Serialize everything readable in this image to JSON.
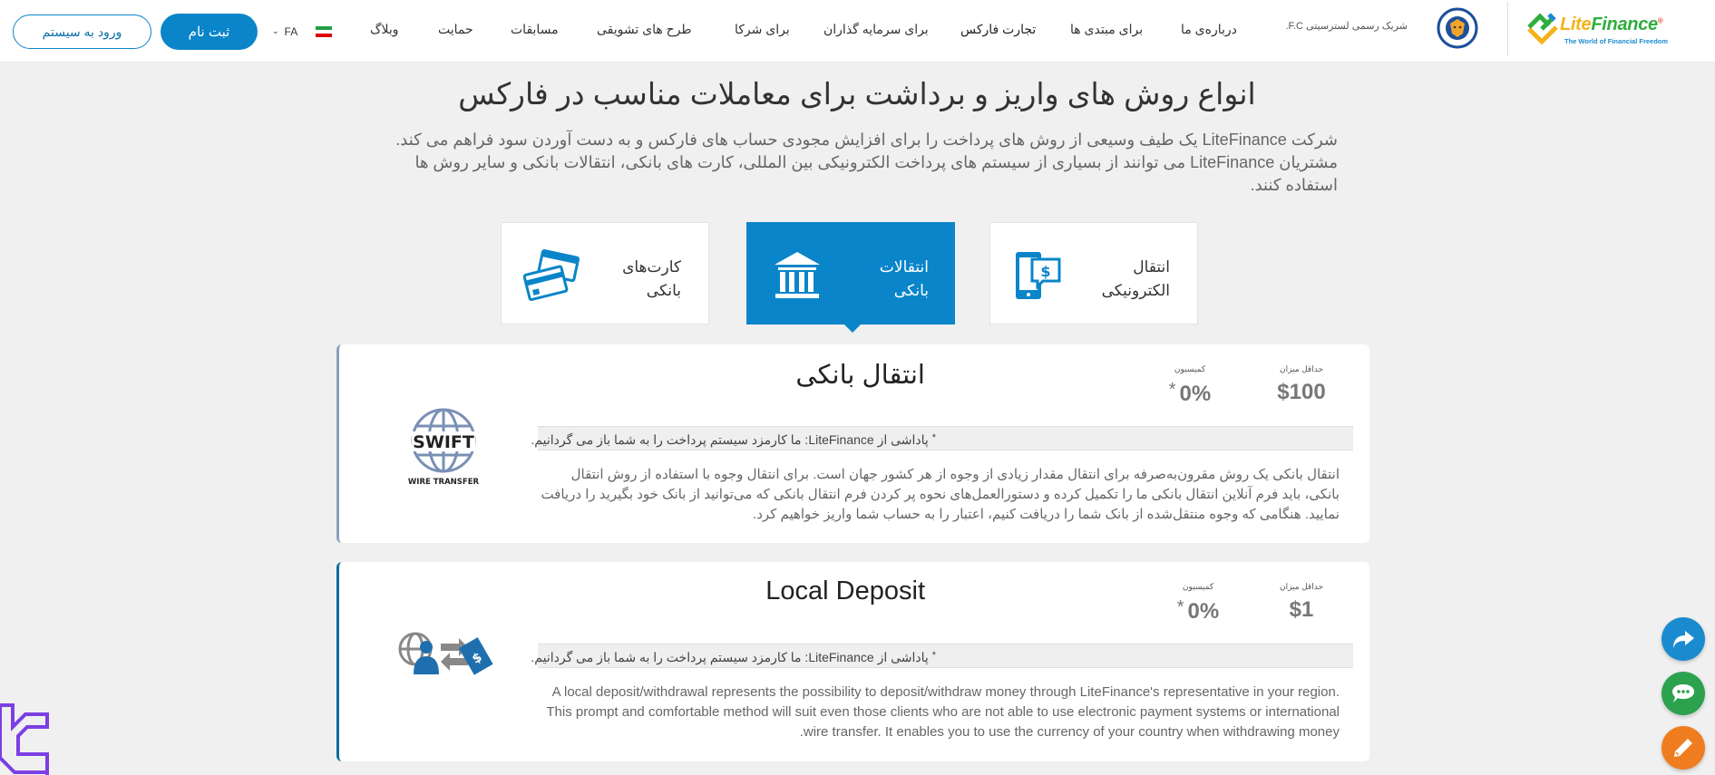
{
  "header": {
    "logo": {
      "brand_part1": "Lite",
      "brand_part2": "Finance",
      "registered": "®",
      "tagline": "The World of Financial Freedom"
    },
    "partner_text": "شریک رسمی لسترسیتی F.C.",
    "nav": [
      {
        "label": "درباره‌ی ما"
      },
      {
        "label": "برای مبتدی ها"
      },
      {
        "label": "تجارت فارکس"
      },
      {
        "label": "برای سرمایه گذاران"
      },
      {
        "label": "برای شرکا"
      },
      {
        "label": "طرح های تشویقی"
      },
      {
        "label": "مسابقات"
      },
      {
        "label": "حمایت"
      },
      {
        "label": "وبلاگ"
      }
    ],
    "language": {
      "code": "FA",
      "chevron": "⌄"
    },
    "register_label": "ثبت نام",
    "login_label": "ورود به سیستم"
  },
  "hero": {
    "title": "انواع روش های واریز و برداشت برای معاملات مناسب در فارکس",
    "intro": "شرکت LiteFinance یک طیف وسیعی از روش های پرداخت را برای افزایش مجودی حساب های فارکس و به دست آوردن سود فراهم می کند. مشتریان LiteFinance می توانند از بسیاری از سیستم های پرداخت الکترونیکی بین المللی، کارت های بانکی، انتقالات بانکی و سایر روش ها استفاده کنند."
  },
  "tabs": [
    {
      "label_line1": "انتقال",
      "label_line2": "الکترونیکی",
      "icon": "mobile-payment-icon",
      "active": false
    },
    {
      "label_line1": "انتقالات",
      "label_line2": "بانکی",
      "icon": "bank-icon",
      "active": true
    },
    {
      "label_line1": "کارت‌های",
      "label_line2": "بانکی",
      "icon": "credit-cards-icon",
      "active": false
    }
  ],
  "methods": [
    {
      "title": "انتقال بانکی",
      "min_label": "حداقل میزان",
      "min_value": "$100",
      "commission_label": "کمیسیون",
      "commission_value": "0%",
      "asterisk": "*",
      "bonus_star": "*",
      "bonus_text": " پاداشی از LiteFinance: ما کارمزد سیستم پرداخت را به شما باز می گردانیم.",
      "description": "انتقال بانکی یک روش مقرون‌به‌صرفه برای انتقال مقدار زیادی از وجوه از هر کشور جهان است. برای انتقال وجوه با استفاده از روش انتقال بانکی، باید فرم آنلاین انتقال بانکی ما را تکمیل کرده و دستورالعمل‌های نحوه پر کردن فرم انتقال بانکی که می‌توانید از بانک خود بگیرید را دریافت نمایید. هنگامی که وجوه منتقل‌شده از بانک شما را دریافت کنیم، اعتبار را به حساب شما واریز خواهیم کرد.",
      "logo": {
        "top_text": "SWIFT",
        "bottom_text": "WIRE TRANSFER"
      }
    },
    {
      "title": "Local Deposit",
      "min_label": "حداقل میزان",
      "min_value": "$1",
      "commission_label": "کمیسیون",
      "commission_value": "0%",
      "asterisk": "*",
      "bonus_star": "*",
      "bonus_text": " پاداشی از LiteFinance: ما کارمزد سیستم پرداخت را به شما باز می گردانیم.",
      "description": "A local deposit/withdrawal represents the possibility to deposit/withdraw money through LiteFinance's representative in your region. This prompt and comfortable method will suit even those clients who are not able to use electronic payment systems or international wire transfer. It enables you to use the currency of your country when withdrawing money."
    }
  ],
  "floating_buttons": [
    {
      "name": "share",
      "icon": "share-arrow-icon"
    },
    {
      "name": "chat",
      "icon": "chat-bubble-icon"
    },
    {
      "name": "edit",
      "icon": "pencil-icon"
    }
  ],
  "colors": {
    "accent": "#0a85c9",
    "page_bg": "#f0f0f0",
    "share": "#1b8bd0",
    "chat": "#2ca24e",
    "edit": "#ef7d1f",
    "brand_yellow": "#f5b21b",
    "brand_green": "#2fae3b",
    "corner_logo": "#7b3fe4"
  }
}
